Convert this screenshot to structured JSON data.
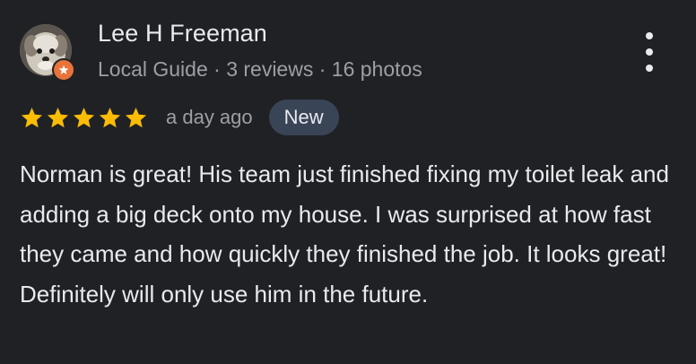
{
  "reviewer": {
    "name": "Lee H Freeman",
    "meta": "Local Guide · 3 reviews · 16 photos",
    "avatar_icon": "dog-avatar",
    "badge_icon": "local-guide-star-badge-icon",
    "badge_color": "#e8743b"
  },
  "rating": {
    "stars": 5,
    "max_stars": 5,
    "star_color": "#fbbc04",
    "time": "a day ago",
    "badge": "New"
  },
  "review": {
    "text": "Norman is great! His team just finished fixing my toilet leak and adding a big deck onto my house. I was surprised at how fast they came and how quickly they finished the job. It looks great! Definitely will only use him in the future."
  },
  "menu": {
    "icon": "more-vert-icon"
  }
}
